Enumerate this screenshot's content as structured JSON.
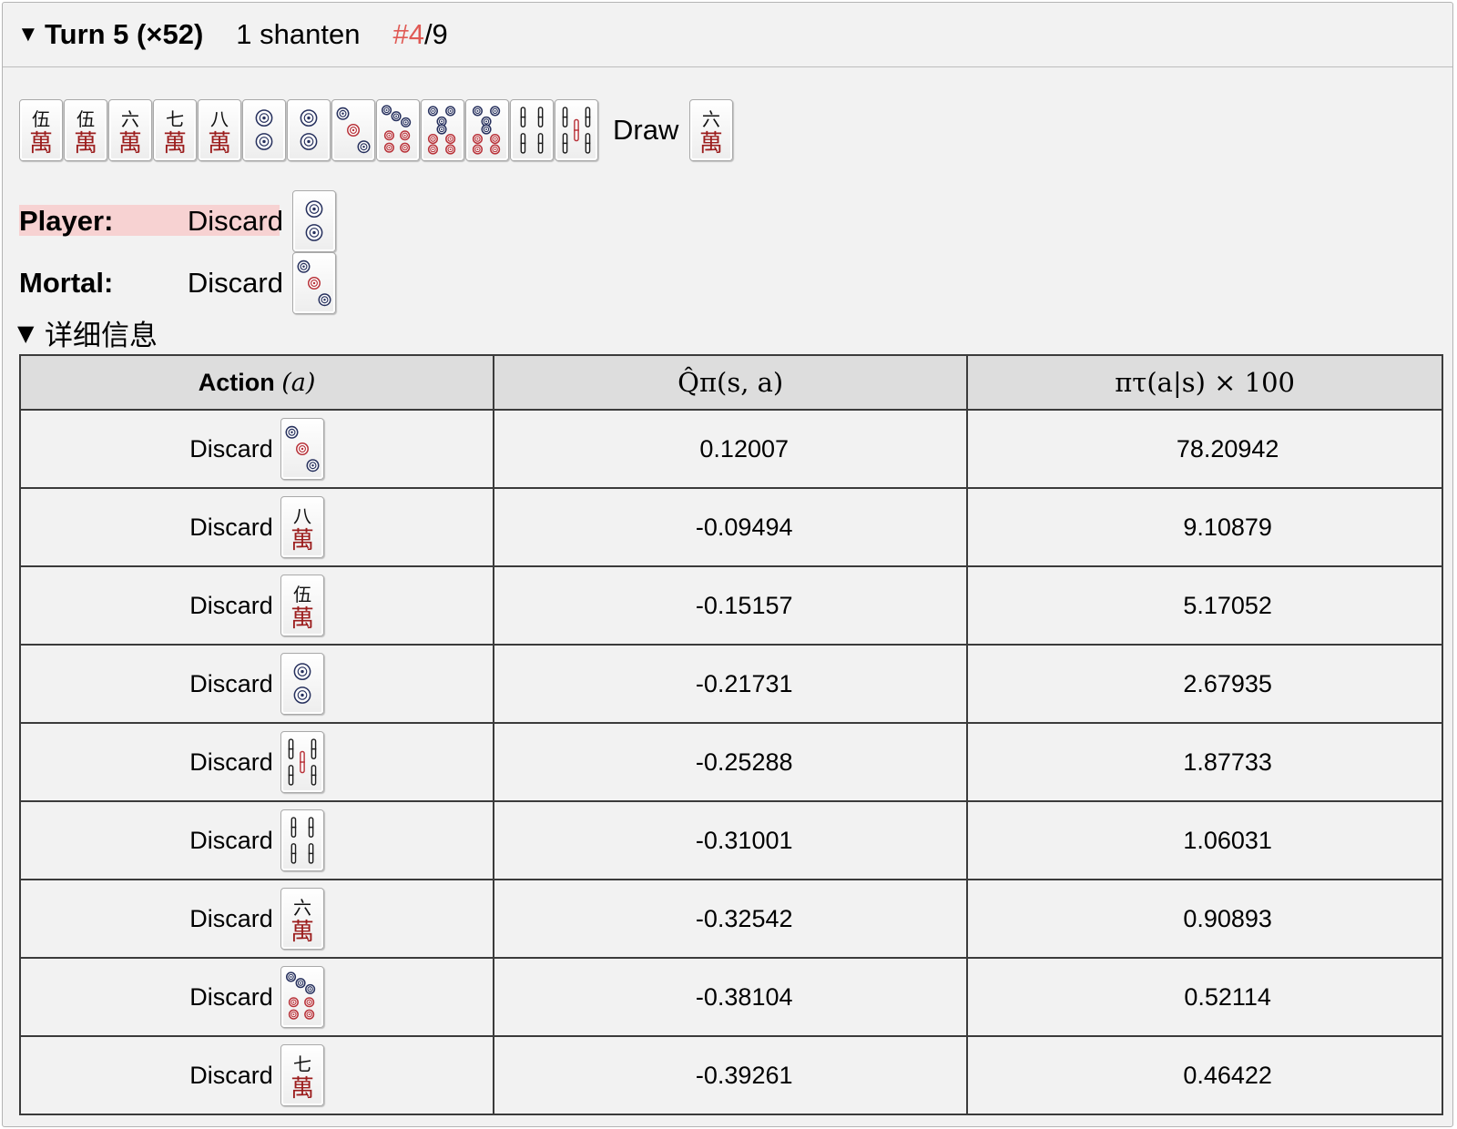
{
  "header": {
    "turn_title": "Turn 5 (×52)",
    "shanten": "1 shanten",
    "rank_hash": "#4",
    "rank_total": "/9",
    "accent_color": "#e05a55"
  },
  "hand": {
    "tiles": [
      "5m",
      "5m",
      "6m",
      "7m",
      "8m",
      "2p",
      "2p",
      "3p",
      "7p",
      "8p",
      "8p",
      "4s",
      "5s"
    ],
    "draw_label": "Draw",
    "draw_tile": "6m"
  },
  "decisions": {
    "player_label": "Player:",
    "player_action": "Discard",
    "player_tile": "2p",
    "mortal_label": "Mortal:",
    "mortal_action": "Discard",
    "mortal_tile": "3p",
    "highlight_color": "#f7d2d2"
  },
  "details": {
    "summary": "详细信息",
    "columns": {
      "action": "Action",
      "action_var": "(a)",
      "q": "Q̂π(s, a)",
      "p": "πτ(a|s) × 100"
    },
    "rows": [
      {
        "action": "Discard",
        "tile": "3p",
        "q": "0.12007",
        "p": "78.20942"
      },
      {
        "action": "Discard",
        "tile": "8m",
        "q": "-0.09494",
        "p": "9.10879"
      },
      {
        "action": "Discard",
        "tile": "5m",
        "q": "-0.15157",
        "p": "5.17052"
      },
      {
        "action": "Discard",
        "tile": "2p",
        "q": "-0.21731",
        "p": "2.67935"
      },
      {
        "action": "Discard",
        "tile": "5s",
        "q": "-0.25288",
        "p": "1.87733"
      },
      {
        "action": "Discard",
        "tile": "4s",
        "q": "-0.31001",
        "p": "1.06031"
      },
      {
        "action": "Discard",
        "tile": "6m",
        "q": "-0.32542",
        "p": "0.90893"
      },
      {
        "action": "Discard",
        "tile": "7p",
        "q": "-0.38104",
        "p": "0.52114"
      },
      {
        "action": "Discard",
        "tile": "7m",
        "q": "-0.39261",
        "p": "0.46422"
      }
    ]
  },
  "tile_faces": {
    "5m": {
      "name": "five-man-tile-icon",
      "numeral": "伍",
      "suit_char": "萬"
    },
    "6m": {
      "name": "six-man-tile-icon",
      "numeral": "六",
      "suit_char": "萬"
    },
    "7m": {
      "name": "seven-man-tile-icon",
      "numeral": "七",
      "suit_char": "萬"
    },
    "8m": {
      "name": "eight-man-tile-icon",
      "numeral": "八",
      "suit_char": "萬"
    },
    "2p": {
      "name": "two-pin-tile-icon"
    },
    "3p": {
      "name": "three-pin-tile-icon"
    },
    "7p": {
      "name": "seven-pin-tile-icon"
    },
    "8p": {
      "name": "eight-pin-tile-icon"
    },
    "4s": {
      "name": "four-sou-tile-icon"
    },
    "5s": {
      "name": "five-sou-tile-icon"
    }
  }
}
